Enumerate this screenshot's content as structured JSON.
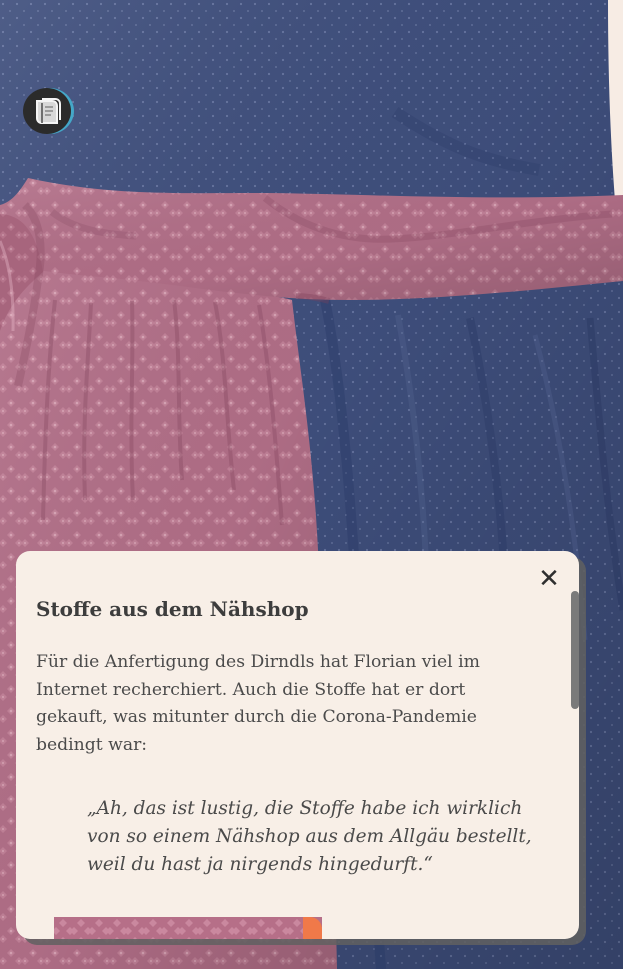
{
  "background": {
    "subject": "Dirndl",
    "colors": {
      "fabric_blue": "#3e4f7b",
      "fabric_pink": "#b06f87",
      "background": "#f7ece4"
    }
  },
  "logo": {
    "icon": "book-icon",
    "colors": {
      "fill": "#2b2b2b",
      "accent": "#44a7c8"
    }
  },
  "info_panel": {
    "title": "Stoffe aus dem Nähshop",
    "body": "Für die Anfertigung des Dirndls hat Florian viel im Internet recherchiert. Auch die Stoffe hat er dort gekauft, was mitunter durch die Corona-Pandemie bedingt war:",
    "quote": "„Ah, das ist lustig, die Stoffe habe ich wirklich von so einem Nähshop aus dem Allgäu bestellt, weil du hast ja nirgends hingedurft.“",
    "close_icon": "close-icon",
    "close_label": "✕",
    "accent_color": "#f07949"
  }
}
